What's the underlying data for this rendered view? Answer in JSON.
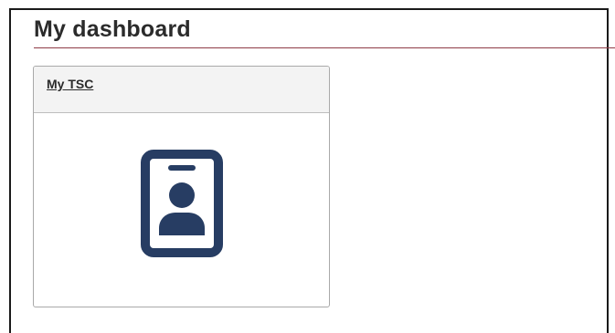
{
  "page": {
    "title": "My dashboard"
  },
  "tiles": [
    {
      "label": "My TSC",
      "icon": "id-badge-icon"
    }
  ],
  "colors": {
    "title_rule": "#8e3b46",
    "icon": "#273d63",
    "tile_header_bg": "#f3f3f3",
    "tile_border": "#a9a9a9"
  }
}
